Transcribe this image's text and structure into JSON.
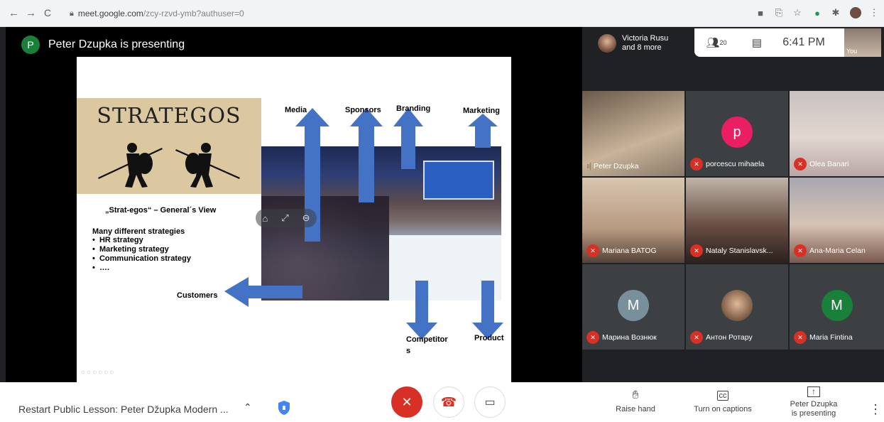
{
  "browser": {
    "url_host": "meet.google.com",
    "url_path": "/zcy-rzvd-ymb?authuser=0"
  },
  "presenting_banner": {
    "avatar_letter": "P",
    "text": "Peter Dzupka is presenting"
  },
  "slide": {
    "logo_title": "STRATEGOS",
    "subtitle": "„Strat-egos“ – General´s View",
    "heading": "Many different strategies",
    "bullets": [
      "HR strategy",
      "Marketing strategy",
      "Communication strategy",
      "…."
    ],
    "labels": {
      "media": "Media",
      "sponsors": "Sponsors",
      "branding": "Branding",
      "marketing": "Marketing",
      "customers": "Customers",
      "competitors": "Competitor\ns",
      "product": "Product"
    }
  },
  "top_bar": {
    "mini_participant": "Victoria Rusu\nand 8 more",
    "participants_count": "20",
    "time": "6:41 PM",
    "you_label": "You"
  },
  "participants": [
    {
      "name": "Peter Dzupka",
      "muted": false,
      "speaking": true,
      "type": "photo"
    },
    {
      "name": "porcescu mihaela",
      "muted": true,
      "type": "letter",
      "letter": "p",
      "color": "#e91e63"
    },
    {
      "name": "Olea Banari",
      "muted": true,
      "type": "photo"
    },
    {
      "name": "Mariana BATOG",
      "muted": true,
      "type": "photo"
    },
    {
      "name": "Nataly Stanislavsk...",
      "muted": true,
      "type": "photo"
    },
    {
      "name": "Ana-Maria Celan",
      "muted": true,
      "type": "photo"
    },
    {
      "name": "Марина Вознюк",
      "muted": true,
      "type": "letter",
      "letter": "M",
      "color": "#78909c"
    },
    {
      "name": "Антон Ротару",
      "muted": true,
      "type": "photo"
    },
    {
      "name": "Maria Fintina",
      "muted": true,
      "type": "letter",
      "letter": "M",
      "color": "#188038"
    }
  ],
  "bottom_bar": {
    "meeting_title": "Restart Public Lesson: Peter Džupka Modern ...",
    "raise_hand": "Raise hand",
    "captions": "Turn on captions",
    "presenting_line1": "Peter Dzupka",
    "presenting_line2": "is presenting"
  },
  "colors": {
    "mute_red": "#d93025",
    "arrow_blue": "#4472c4",
    "meet_dark": "#202124"
  }
}
